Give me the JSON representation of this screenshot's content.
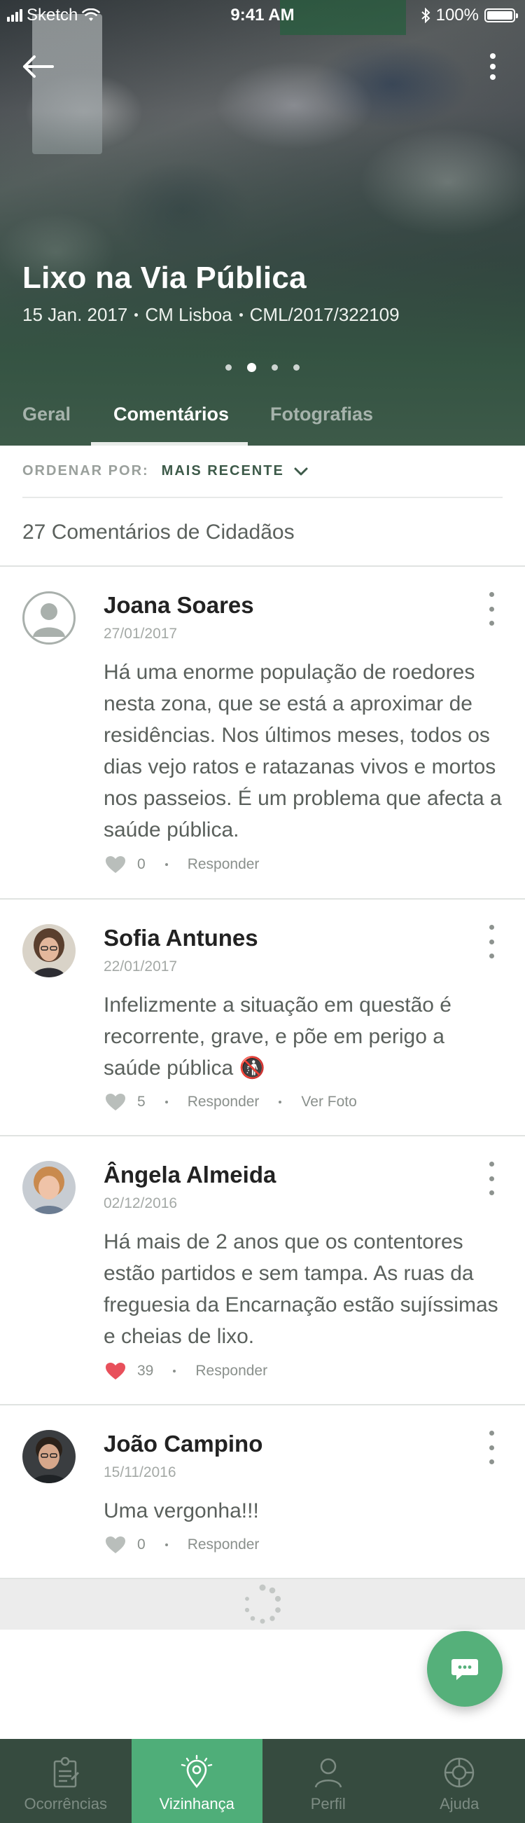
{
  "status_bar": {
    "carrier": "Sketch",
    "time": "9:41 AM",
    "battery": "100%"
  },
  "header": {
    "title": "Lixo na Via Pública",
    "meta": [
      "15 Jan. 2017",
      "CM Lisboa",
      "CML/2017/322109"
    ],
    "pager": {
      "count": 4,
      "active_index": 1
    }
  },
  "tabs": [
    {
      "label": "Geral",
      "active": false
    },
    {
      "label": "Comentários",
      "active": true
    },
    {
      "label": "Fotografias",
      "active": false
    }
  ],
  "sort": {
    "label": "ORDENAR POR:",
    "value": "MAIS RECENTE"
  },
  "comments_count_text": "27 Comentários de Cidadãos",
  "comments": [
    {
      "name": "Joana Soares",
      "date": "27/01/2017",
      "text": "Há uma enorme população de roedores nesta zona, que se está a aproximar de residências. Nos últimos meses, todos os dias vejo ratos e ratazanas vivos e mortos nos passeios. É um problema que afecta a saúde pública.",
      "likes": "0",
      "liked": false,
      "reply_label": "Responder",
      "avatar": "placeholder-avatar-icon"
    },
    {
      "name": "Sofia Antunes",
      "date": "22/01/2017",
      "text": "Infelizmente a situação em questão é recorrente, grave, e põe em perigo a saúde pública 🚯",
      "likes": "5",
      "liked": false,
      "reply_label": "Responder",
      "photo_label": "Ver Foto",
      "avatar": "photo-avatar"
    },
    {
      "name": "Ângela Almeida",
      "date": "02/12/2016",
      "text": "Há mais de 2 anos que os contentores estão partidos e sem tampa. As ruas da freguesia da Encarnação estão sujíssimas e cheias de lixo.",
      "likes": "39",
      "liked": true,
      "reply_label": "Responder",
      "avatar": "photo-avatar"
    },
    {
      "name": "João Campino",
      "date": "15/11/2016",
      "text": "Uma vergonha!!!",
      "likes": "0",
      "liked": false,
      "reply_label": "Responder",
      "avatar": "photo-avatar"
    }
  ],
  "bottom_nav": [
    {
      "label": "Ocorrências",
      "icon": "clipboard-icon",
      "active": false
    },
    {
      "label": "Vizinhança",
      "icon": "location-pin-icon",
      "active": true
    },
    {
      "label": "Perfil",
      "icon": "user-icon",
      "active": false
    },
    {
      "label": "Ajuda",
      "icon": "lifebuoy-icon",
      "active": false
    }
  ],
  "colors": {
    "brand_green": "#4fae79",
    "dark_green": "#364b3f",
    "like_red": "#e8505b",
    "fab_green": "#55b07a"
  }
}
